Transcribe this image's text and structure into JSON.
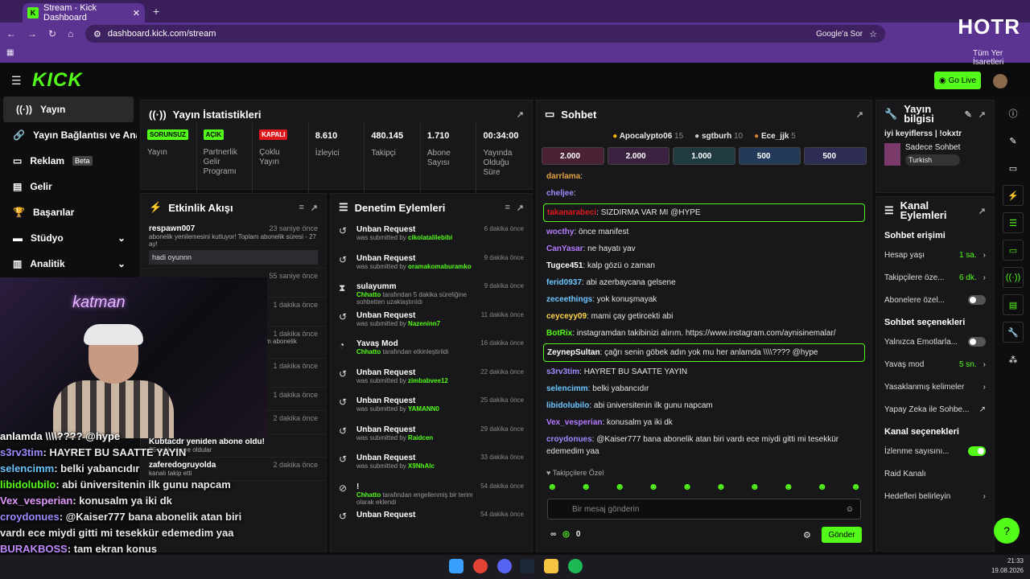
{
  "browser": {
    "tab_title": "Stream - Kick Dashboard",
    "url": "dashboard.kick.com/stream",
    "google_button": "Google'a Sor",
    "bookmarks_label": "Tüm Yer İşaretleri",
    "overlay_logo": "HOTR"
  },
  "header": {
    "logo": "KICK",
    "go_live": "Go Live"
  },
  "sidebar": {
    "items": [
      {
        "label": "Yayın"
      },
      {
        "label": "Yayın Bağlantısı ve Anahtarı"
      },
      {
        "label": "Reklam",
        "badge": "Beta"
      },
      {
        "label": "Gelir"
      },
      {
        "label": "Başarılar"
      },
      {
        "label": "Stüdyo"
      },
      {
        "label": "Analitik"
      }
    ]
  },
  "stats": {
    "title": "Yayın İstatistikleri",
    "items": [
      {
        "badge": "SORUNSUZ",
        "label": "Yayın"
      },
      {
        "badge": "AÇIK",
        "label": "Partnerlik Gelir Programı"
      },
      {
        "badge": "KAPALI",
        "label": "Çoklu Yayın"
      },
      {
        "value": "8.610",
        "label": "İzleyici"
      },
      {
        "value": "480.145",
        "label": "Takipçi"
      },
      {
        "value": "1.710",
        "label": "Abone Sayısı"
      },
      {
        "value": "00:34:00",
        "label": "Yayında Olduğu Süre"
      }
    ]
  },
  "activity": {
    "title": "Etkinlik Akışı",
    "items": [
      {
        "name": "respawn007",
        "time": "23 saniye önce",
        "desc": "abonelik yenilemesini kutluyor! Toplam abonelik süresi - 27 ay!",
        "msg": "hadi oyunnn"
      },
      {
        "name": "",
        "time": "55 saniye önce",
        "desc": "",
        "msg": ""
      },
      {
        "name": "",
        "time": "1 dakika önce",
        "desc": "",
        "msg": ""
      },
      {
        "name": "",
        "time": "1 dakika önce",
        "desc": "oplam abonelik",
        "msg": ""
      },
      {
        "name": "",
        "time": "1 dakika önce",
        "desc": "",
        "msg": ""
      },
      {
        "name": "bura0",
        "time": "1 dakika önce",
        "desc": "kanalı takip etti",
        "msg": ""
      },
      {
        "name": "Merdovannivan",
        "time": "2 dakika önce",
        "desc": "kanalı takip etti",
        "msg": ""
      },
      {
        "name": "Kubtacdr yeniden abone oldu!",
        "time": "",
        "desc": "26 aylık abone oldular",
        "msg": ""
      },
      {
        "name": "zaferedogruyolda",
        "time": "2 dakika önce",
        "desc": "kanalı takip etti",
        "msg": ""
      }
    ]
  },
  "moderation": {
    "title": "Denetim Eylemleri",
    "items": [
      {
        "name": "Unban Request",
        "sub": "was submitted by",
        "user": "cikolatalilebibi",
        "time": "6 dakika önce"
      },
      {
        "name": "Unban Request",
        "sub": "was submitted by",
        "user": "oramakomaburamko",
        "time": "9 dakika önce"
      },
      {
        "name": "sulayumm",
        "sub": "tarafından 5 dakika süreliğine sohbetten uzaklaştırıldı",
        "user": "Chhatto",
        "time": "9 dakika önce"
      },
      {
        "name": "Unban Request",
        "sub": "was submitted by",
        "user": "Nazeninn7",
        "time": "11 dakika önce"
      },
      {
        "name": "Yavaş Mod",
        "sub": "tarafından etkinleştirildi",
        "user": "Chhatto",
        "time": "16 dakika önce"
      },
      {
        "name": "Unban Request",
        "sub": "was submitted by",
        "user": "zimbabvee12",
        "time": "22 dakika önce"
      },
      {
        "name": "Unban Request",
        "sub": "was submitted by",
        "user": "YAMANN0",
        "time": "25 dakika önce"
      },
      {
        "name": "Unban Request",
        "sub": "was submitted by",
        "user": "Raidcen",
        "time": "29 dakika önce"
      },
      {
        "name": "Unban Request",
        "sub": "was submitted by",
        "user": "X9NhAlc",
        "time": "33 dakika önce"
      },
      {
        "name": "!",
        "sub": "tarafından engellenmiş bir terim olarak eklendi",
        "user": "Chhatto",
        "time": "54 dakika önce"
      },
      {
        "name": "Unban Request",
        "sub": "",
        "user": "",
        "time": "54 dakika önce"
      }
    ]
  },
  "chat": {
    "title": "Sohbet",
    "top": [
      {
        "name": "Apocalypto06",
        "count": "15"
      },
      {
        "name": "sgtburh",
        "count": "10"
      },
      {
        "name": "Ece_jjk",
        "count": "5"
      }
    ],
    "gifts": [
      "2.000",
      "2.000",
      "1.000",
      "500",
      "500"
    ],
    "messages": [
      {
        "user": "darrlama",
        "color": "#e6a23c",
        "text": ":"
      },
      {
        "user": "cheljee",
        "color": "#9b8cff",
        "text": ":"
      },
      {
        "user": "takanarabeci",
        "color": "#e0181e",
        "text": ": SIZDIRMA VAR MI @HYPE",
        "box": true
      },
      {
        "user": "wocthy",
        "color": "#b57cff",
        "text": ": önce manifest"
      },
      {
        "user": "CanYasar",
        "color": "#b57cff",
        "text": ": ne hayatı yav"
      },
      {
        "user": "Tugce451",
        "color": "#ffffff",
        "text": ": kalp gözü o zaman"
      },
      {
        "user": "ferid0937",
        "color": "#6cc6ff",
        "text": ": abi azerbaycana gelsene"
      },
      {
        "user": "zeceethings",
        "color": "#6cc6ff",
        "text": ": yok konuşmayak"
      },
      {
        "user": "ceyceyy09",
        "color": "#ffd54a",
        "text": ": mami çay getircekti abi"
      },
      {
        "user": "BotRix",
        "color": "#53fc18",
        "text": ": instagramdan takibinizi alırım. https://www.instagram.com/aynisinemalar/"
      },
      {
        "user": "ZeynepSultan",
        "color": "#ffffff",
        "text": ": çağrı senin göbek adın yok mu her anlamda \\\\\\\\???? @hype",
        "box": true
      },
      {
        "user": "s3rv3tim",
        "color": "#9b8cff",
        "text": ": HAYRET BU SAATTE YAYIN"
      },
      {
        "user": "selencimm",
        "color": "#6cc6ff",
        "text": ": belki yabancıdır"
      },
      {
        "user": "libidolubilo",
        "color": "#6cc6ff",
        "text": ": abi üniversitenin ilk gunu napcam"
      },
      {
        "user": "Vex_vesperian",
        "color": "#b57cff",
        "text": ": konusalm ya iki dk"
      },
      {
        "user": "croydonues",
        "color": "#9b8cff",
        "text": ": @Kaiser777 bana abonelik atan biri vardı ece miydi gitti mi tesekkür edemedim yaa"
      }
    ],
    "followers_only": "Takipçilere Özel",
    "input_placeholder": "Bir mesaj gönderin",
    "points": "0",
    "send": "Gönder"
  },
  "stream_info": {
    "title": "Yayın bilgisi",
    "stream_title": "iyi keyiflerss | !okxtr",
    "category": "Sadece Sohbet",
    "language": "Turkish"
  },
  "channel_actions": {
    "title": "Kanal Eylemleri",
    "chat_access": "Sohbet erişimi",
    "account_age": {
      "label": "Hesap yaşı",
      "value": "1 sa."
    },
    "followers": {
      "label": "Takipçilere öze...",
      "value": "6 dk."
    },
    "subscribers": {
      "label": "Abonelere özel..."
    },
    "chat_options": "Sohbet seçenekleri",
    "emotes_only": {
      "label": "Yalnızca Emotlarla..."
    },
    "slow_mode": {
      "label": "Yavaş mod",
      "value": "5 sn."
    },
    "banned_words": {
      "label": "Yasaklanmış kelimeler"
    },
    "ai": {
      "label": "Yapay Zeka ile Sohbe..."
    },
    "channel_options": "Kanal seçenekleri",
    "view_count": {
      "label": "İzlenme sayısını..."
    },
    "raid": {
      "label": "Raid Kanalı"
    },
    "goals": {
      "label": "Hedefleri belirleyin"
    }
  },
  "overlay_chat": [
    {
      "user": "",
      "text": "anlamda \\\\\\\\???? @hype",
      "color": "#fff"
    },
    {
      "user": "s3rv3tim",
      "text": ": HAYRET BU SAATTE YAYIN",
      "color": "#9b8cff"
    },
    {
      "user": "selencimm",
      "text": ": belki yabancıdır",
      "color": "#6cc6ff"
    },
    {
      "user": "libidolubilo",
      "text": ": abi üniversitenin ilk gunu napcam",
      "color": "#53fc18"
    },
    {
      "user": "Vex_vesperian",
      "text": ": konusalm ya iki dk",
      "color": "#e39bff"
    },
    {
      "user": "croydonues",
      "text": ": @Kaiser777 bana abonelik atan biri",
      "color": "#9b8cff"
    },
    {
      "user": "",
      "text": "vardı ece miydi gitti mi tesekkür edemedim yaa",
      "color": "#fff"
    },
    {
      "user": "BURAKBOSS",
      "text": ": tam ekran konus",
      "color": "#c38bff"
    }
  ],
  "cam": {
    "neon": "katman"
  },
  "taskbar": {
    "time": "21:33",
    "date": "19.08.2026"
  },
  "colors": {
    "accent": "#53fc18",
    "panel": "#18181b",
    "browser": "#5b3390"
  }
}
